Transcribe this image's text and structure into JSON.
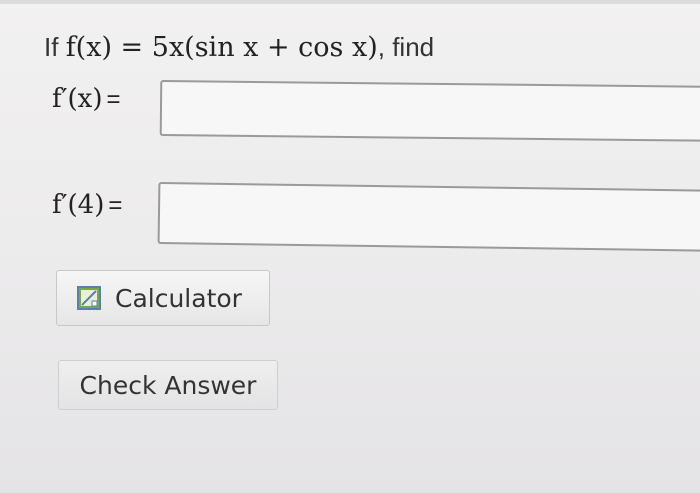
{
  "question": {
    "prefix": "If",
    "function_expression": "f(x) = 5x(sin x + cos x)",
    "suffix": ", find"
  },
  "rows": [
    {
      "label": "f′(x)",
      "equals": "=",
      "value": ""
    },
    {
      "label": "f′(4)",
      "equals": "=",
      "value": ""
    }
  ],
  "buttons": {
    "calculator_label": "Calculator",
    "check_label": "Check Answer"
  },
  "icons": {
    "calculator": "calculator-icon"
  },
  "colors": {
    "background": "#ececec",
    "input_border": "#9a9a9a",
    "icon_green": "#79a84b",
    "icon_blue": "#5b7fb0"
  }
}
